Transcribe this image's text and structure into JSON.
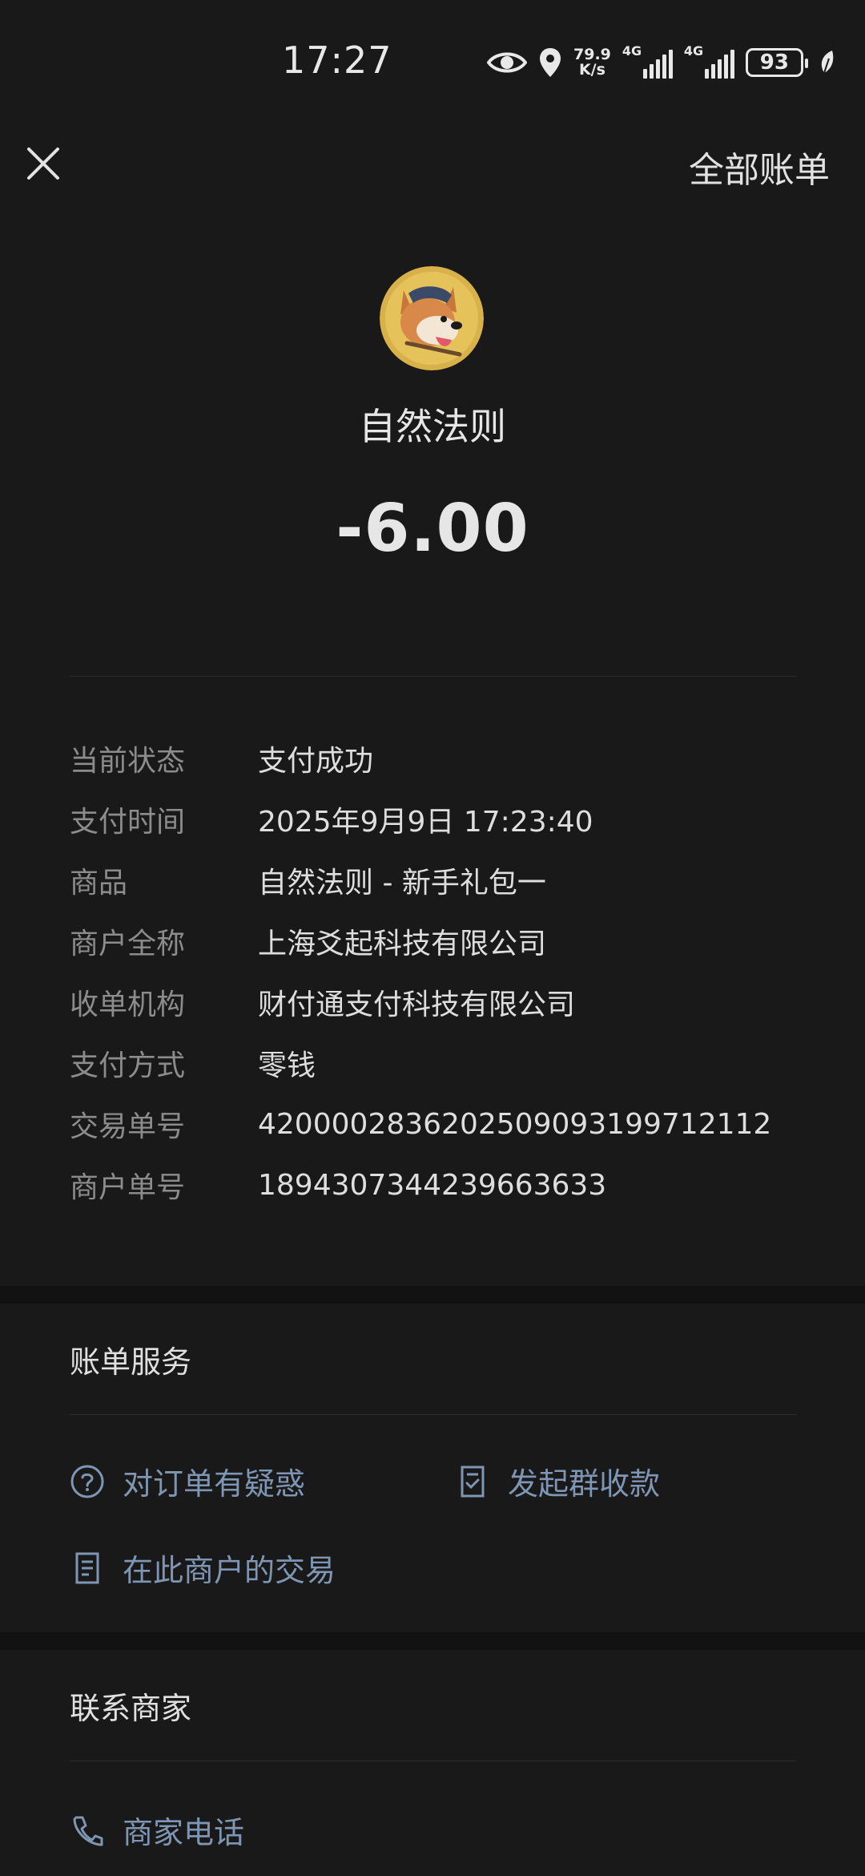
{
  "status_bar": {
    "time": "17:27",
    "speed_value": "79.9",
    "speed_unit": "K/s",
    "net_label_1": "4G",
    "net_label_2": "4G",
    "battery": "93",
    "icons": [
      "eye-icon",
      "location-icon",
      "signal-icon",
      "battery-icon",
      "leaf-icon"
    ]
  },
  "header": {
    "close_icon": "close-icon",
    "all_bills_label": "全部账单"
  },
  "merchant": {
    "avatar_icon": "corgi-avatar",
    "name": "自然法则",
    "amount": "-6.00"
  },
  "details": [
    {
      "label": "当前状态",
      "value": "支付成功"
    },
    {
      "label": "支付时间",
      "value": "2025年9月9日 17:23:40"
    },
    {
      "label": "商品",
      "value": "自然法则 - 新手礼包一"
    },
    {
      "label": "商户全称",
      "value": "上海爻起科技有限公司"
    },
    {
      "label": "收单机构",
      "value": "财付通支付科技有限公司"
    },
    {
      "label": "支付方式",
      "value": "零钱"
    },
    {
      "label": "交易单号",
      "value": "4200002836202509093199712112"
    },
    {
      "label": "商户单号",
      "value": "1894307344239663633"
    }
  ],
  "bill_service": {
    "title": "账单服务",
    "question_label": "对订单有疑惑",
    "group_collect_label": "发起群收款",
    "merchant_trades_label": "在此商户的交易"
  },
  "contact": {
    "title": "联系商家",
    "phone_label": "商家电话"
  },
  "colors": {
    "background": "#191919",
    "section_gap": "#121212",
    "link": "#7e96b4",
    "label": "#8c8c8c",
    "text": "#dedede"
  }
}
